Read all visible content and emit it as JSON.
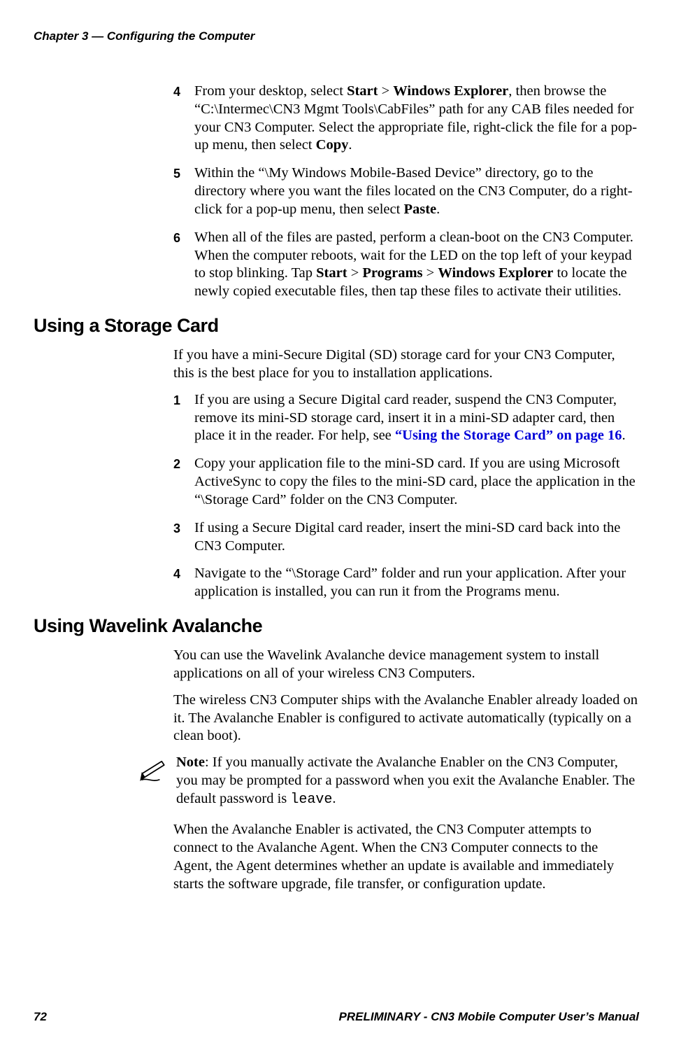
{
  "header": {
    "running_title": "Chapter 3 — Configuring the Computer"
  },
  "steps_top": [
    {
      "num": "4",
      "parts": [
        "From your desktop, select ",
        {
          "b": "Start"
        },
        " > ",
        {
          "b": "Windows Explorer"
        },
        ", then browse the “C:\\Intermec\\CN3 Mgmt Tools\\CabFiles” path for any CAB files needed for your CN3 Computer. Select the appropriate file, right-click the file for a pop-up menu, then select ",
        {
          "b": "Copy"
        },
        "."
      ]
    },
    {
      "num": "5",
      "parts": [
        "Within the “\\My Windows Mobile-Based Device” directory, go to the directory where you want the files located on the CN3 Computer, do a right-click for a pop-up menu, then select ",
        {
          "b": "Paste"
        },
        "."
      ]
    },
    {
      "num": "6",
      "parts": [
        "When all of the files are pasted, perform a clean-boot on the CN3 Computer. When the computer reboots, wait for the LED on the top left of your keypad to stop blinking. Tap ",
        {
          "b": "Start"
        },
        " > ",
        {
          "b": "Programs"
        },
        " > ",
        {
          "b": "Windows Explorer"
        },
        " to locate the newly copied executable files, then tap these files to activate their utilities."
      ]
    }
  ],
  "section1": {
    "heading": "Using a Storage Card",
    "intro": "If you have a mini-Secure Digital (SD) storage card for your CN3 Computer, this is the best place for you to installation applications.",
    "steps": [
      {
        "num": "1",
        "parts": [
          "If you are using a Secure Digital card reader, suspend the CN3 Computer, remove its mini-SD storage card, insert it in a mini-SD adapter card, then place it in the reader. For help, see ",
          {
            "xref": "“Using the Storage Card” on page 16"
          },
          "."
        ]
      },
      {
        "num": "2",
        "parts": [
          "Copy your application file to the mini-SD card. If you are using Microsoft ActiveSync to copy the files to the mini-SD card, place the application in the “\\Storage Card” folder on the CN3 Computer."
        ]
      },
      {
        "num": "3",
        "parts": [
          "If using a Secure Digital card reader, insert the mini-SD card back into the CN3 Computer."
        ]
      },
      {
        "num": "4",
        "parts": [
          "Navigate to the “\\Storage Card” folder and run your application. After your application is installed, you can run it from the Programs menu."
        ]
      }
    ]
  },
  "section2": {
    "heading": "Using Wavelink Avalanche",
    "paras": [
      "You can use the Wavelink Avalanche device management system to install applications on all of your wireless CN3 Computers.",
      "The wireless CN3 Computer ships with the Avalanche Enabler already loaded on it. The Avalanche Enabler is configured to activate automatically (typically on a clean boot)."
    ],
    "note": {
      "parts": [
        {
          "b": "Note"
        },
        ": If you manually activate the Avalanche Enabler on the CN3 Computer, you may be prompted for a password when you exit the Avalanche Enabler. The default password is ",
        {
          "mono": "leave"
        },
        "."
      ]
    },
    "after_note": "When the Avalanche Enabler is activated, the CN3 Computer attempts to connect to the Avalanche Agent. When the CN3 Computer connects to the Agent, the Agent determines whether an update is available and immediately starts the software upgrade, file transfer, or configuration update."
  },
  "footer": {
    "page_number": "72",
    "doc_title": "PRELIMINARY - CN3 Mobile Computer User’s Manual"
  }
}
